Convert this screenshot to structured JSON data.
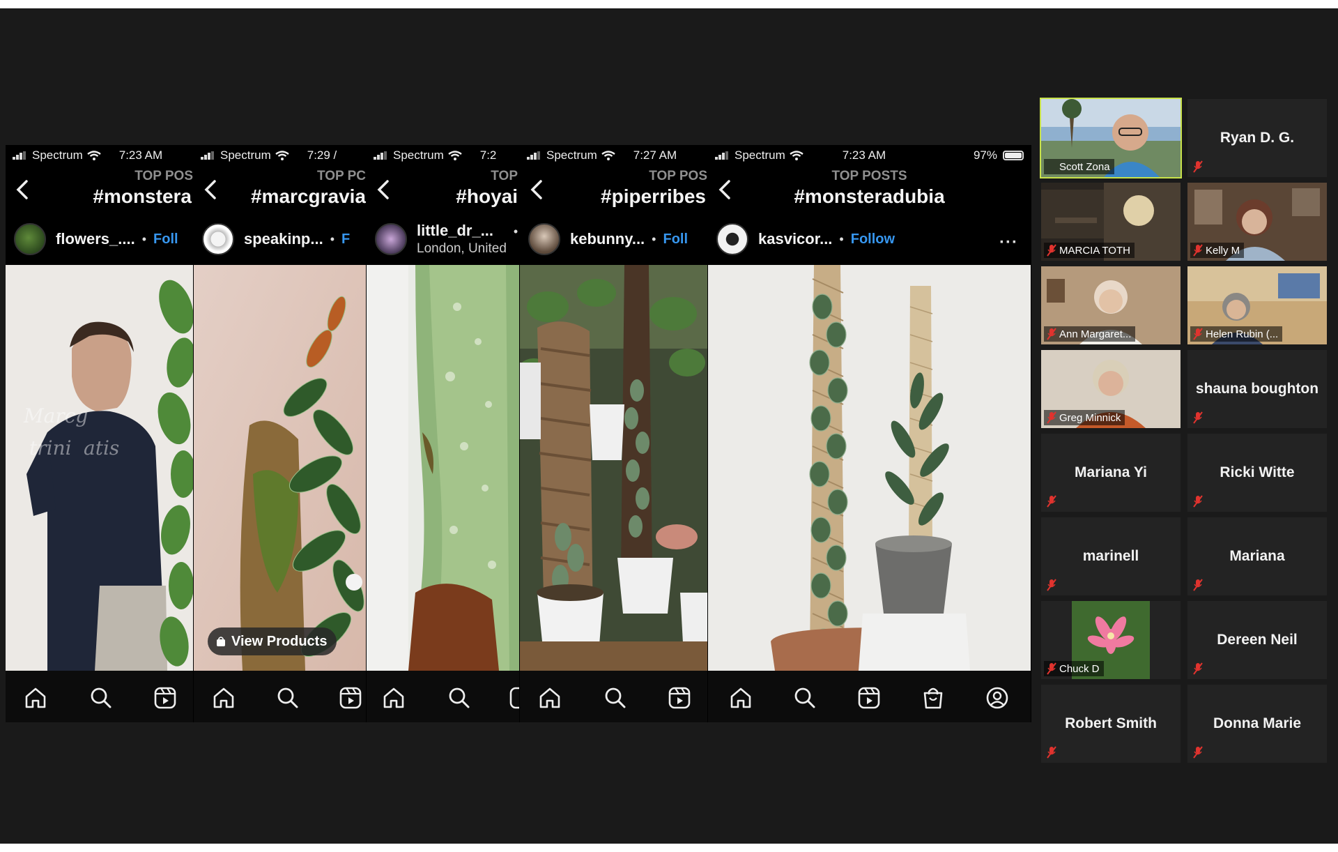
{
  "panels": [
    {
      "carrier": "Spectrum",
      "time": "7:23 AM",
      "top_label": "TOP POS",
      "hashtag": "#monstera",
      "username": "flowers_....",
      "location": "",
      "follow": "Foll",
      "overlay_text": [
        "Marcg",
        "trini",
        "atis"
      ]
    },
    {
      "carrier": "Spectrum",
      "time": "7:29 /",
      "top_label": "TOP PC",
      "hashtag": "#marcgravia",
      "username": "speakinp...",
      "location": "",
      "follow": "F",
      "view_products": "View Products"
    },
    {
      "carrier": "Spectrum",
      "time": "7:2",
      "top_label": "TOP",
      "hashtag": "#hoyai",
      "username": "little_dr_...",
      "location": "London, United",
      "follow": ""
    },
    {
      "carrier": "Spectrum",
      "time": "7:27 AM",
      "top_label": "TOP POS",
      "hashtag": "#piperribes",
      "username": "kebunny...",
      "location": "",
      "follow": "Foll"
    },
    {
      "carrier": "Spectrum",
      "time": "7:23 AM",
      "battery": "97%",
      "top_label": "TOP POSTS",
      "hashtag": "#monsteradubia",
      "username": "kasvicor...",
      "location": "",
      "follow": "Follow",
      "more": "···"
    }
  ],
  "nav_icons": [
    "home-icon",
    "search-icon",
    "reels-icon",
    "shop-icon",
    "profile-icon"
  ],
  "participants": [
    {
      "name": "Scott Zona",
      "video": true,
      "active": true
    },
    {
      "name": "Ryan D. G.",
      "video": false
    },
    {
      "name": "MARCIA TOTH",
      "video": true
    },
    {
      "name": "Kelly M",
      "video": true
    },
    {
      "name": "Ann Margaret...",
      "video": true
    },
    {
      "name": "Helen Rubin (...",
      "video": true
    },
    {
      "name": "Greg Minnick",
      "video": true
    },
    {
      "name": "shauna boughton",
      "video": false
    },
    {
      "name": "Mariana Yi",
      "video": false
    },
    {
      "name": "Ricki Witte",
      "video": false
    },
    {
      "name": "marinell",
      "video": false
    },
    {
      "name": "Mariana",
      "video": false
    },
    {
      "name": "Chuck D",
      "video": true
    },
    {
      "name": "Dereen Neil",
      "video": false
    },
    {
      "name": "Robert Smith",
      "video": false
    },
    {
      "name": "Donna Marie",
      "video": false
    }
  ],
  "colors": {
    "active_speaker": "#c8e24a",
    "follow": "#3797f0",
    "muted": "#e0332e",
    "background": "#1a1a1a"
  }
}
